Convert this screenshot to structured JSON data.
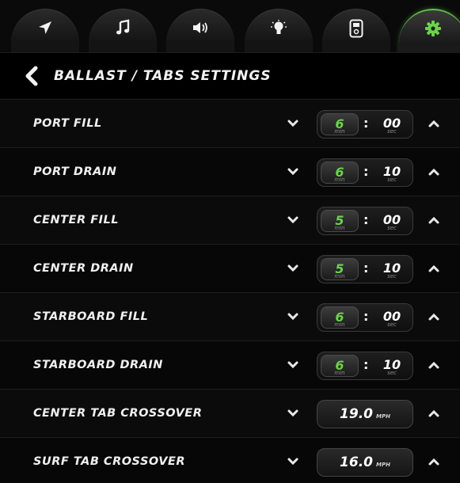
{
  "tabs": [
    {
      "icon": "navigation-arrow-icon"
    },
    {
      "icon": "music-note-icon"
    },
    {
      "icon": "speaker-volume-icon"
    },
    {
      "icon": "light-bulb-icon"
    },
    {
      "icon": "remote-device-icon"
    },
    {
      "icon": "gear-icon",
      "active": true
    }
  ],
  "colors": {
    "accent": "#6dd24b",
    "background": "#050505",
    "text": "#ffffff"
  },
  "header": {
    "title": "BALLAST / TABS SETTINGS"
  },
  "rows": [
    {
      "label": "PORT FILL",
      "min": "6",
      "min_unit": "min",
      "sec": "00",
      "sec_unit": "sec"
    },
    {
      "label": "PORT DRAIN",
      "min": "6",
      "min_unit": "min",
      "sec": "10",
      "sec_unit": "sec"
    },
    {
      "label": "CENTER FILL",
      "min": "5",
      "min_unit": "min",
      "sec": "00",
      "sec_unit": "sec"
    },
    {
      "label": "CENTER DRAIN",
      "min": "5",
      "min_unit": "min",
      "sec": "10",
      "sec_unit": "sec"
    },
    {
      "label": "STARBOARD FILL",
      "min": "6",
      "min_unit": "min",
      "sec": "00",
      "sec_unit": "sec"
    },
    {
      "label": "STARBOARD DRAIN",
      "min": "6",
      "min_unit": "min",
      "sec": "10",
      "sec_unit": "sec"
    },
    {
      "label": "CENTER TAB CROSSOVER",
      "value": "19.0",
      "unit": "MPH"
    },
    {
      "label": "SURF TAB CROSSOVER",
      "value": "16.0",
      "unit": "MPH"
    }
  ]
}
